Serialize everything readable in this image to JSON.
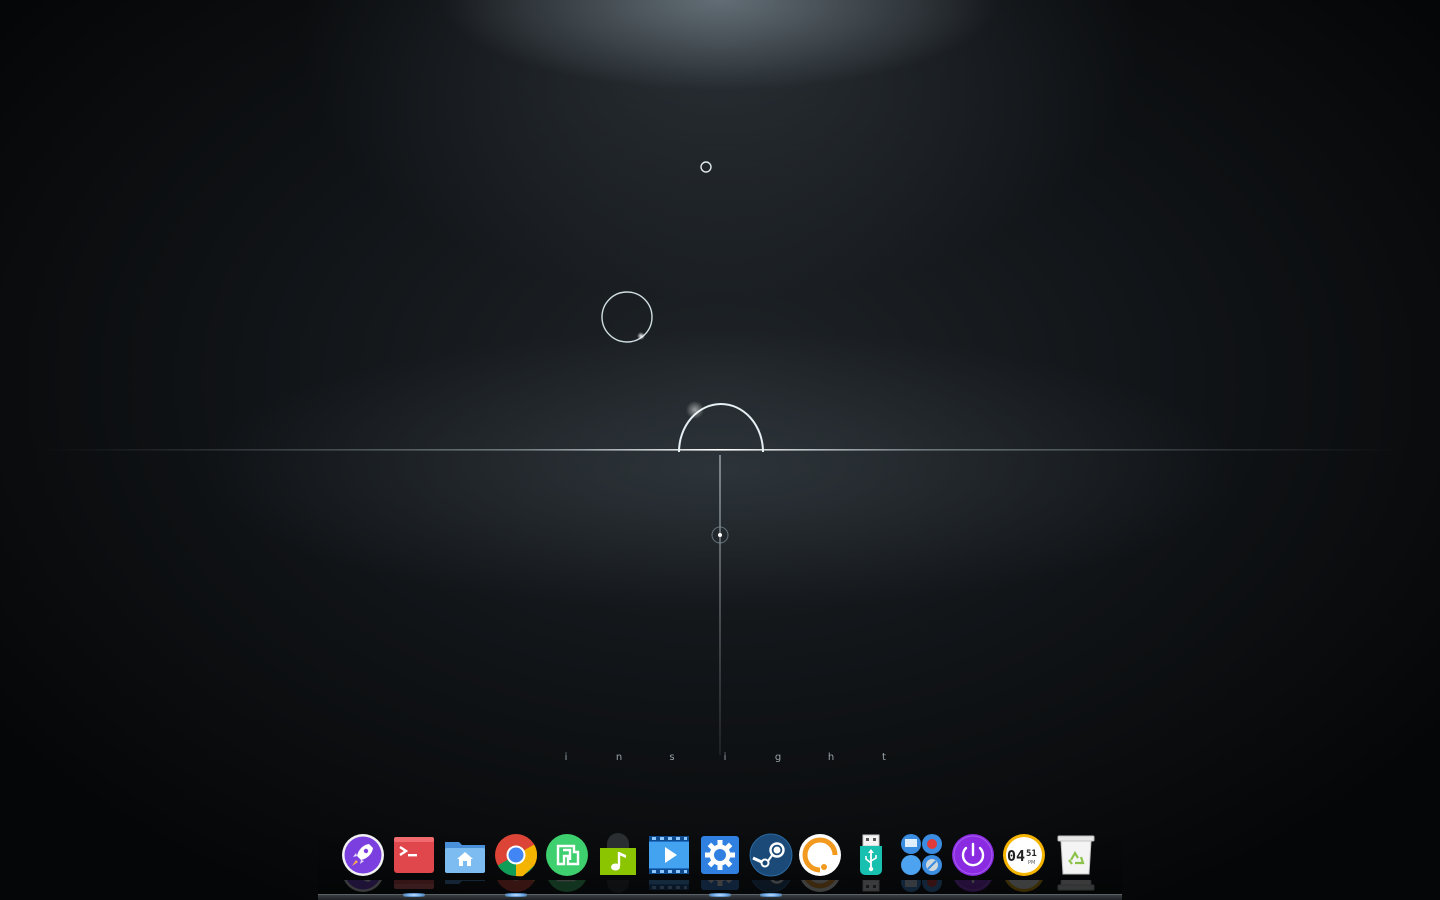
{
  "wallpaper": {
    "word_letters": [
      "i",
      "n",
      "s",
      "i",
      "g",
      "h",
      "t"
    ]
  },
  "dock": {
    "items": [
      {
        "name": "launcher",
        "icon": "rocket-icon",
        "color": "#7b3fe0",
        "running": false
      },
      {
        "name": "terminal",
        "icon": "terminal-icon",
        "color": "#e0474c",
        "running": true
      },
      {
        "name": "file-manager",
        "icon": "home-folder-icon",
        "color": "#5fa8e8",
        "running": false
      },
      {
        "name": "google-chrome",
        "icon": "chrome-icon",
        "color": "#4285f4",
        "running": true
      },
      {
        "name": "app-store",
        "icon": "store-icon",
        "color": "#3ecf6e",
        "running": false
      },
      {
        "name": "music-player",
        "icon": "music-note-icon",
        "color": "#8bc400",
        "running": false
      },
      {
        "name": "video-player",
        "icon": "film-play-icon",
        "color": "#2f8fe8",
        "running": false
      },
      {
        "name": "system-settings",
        "icon": "gear-icon",
        "color": "#2f80e0",
        "running": true
      },
      {
        "name": "steam",
        "icon": "steam-icon",
        "color": "#1b4a78",
        "running": true
      },
      {
        "name": "feedback",
        "icon": "headset-icon",
        "color": "#f29a1f",
        "running": false
      },
      {
        "name": "usb-boot-maker",
        "icon": "usb-icon",
        "color": "#18c0b0",
        "running": false
      },
      {
        "name": "multitasking-view",
        "icon": "workspaces-icon",
        "color": "#3a8de0",
        "running": false
      },
      {
        "name": "shutdown",
        "icon": "power-icon",
        "color": "#8a2be2",
        "running": false
      },
      {
        "name": "clock",
        "icon": "clock-icon",
        "color": "#f5b400",
        "running": false,
        "time_text": "04",
        "minutes_text": "51",
        "ampm_text": "PM"
      },
      {
        "name": "trash",
        "icon": "trash-icon",
        "color": "#f0f0f0",
        "running": false
      }
    ]
  }
}
